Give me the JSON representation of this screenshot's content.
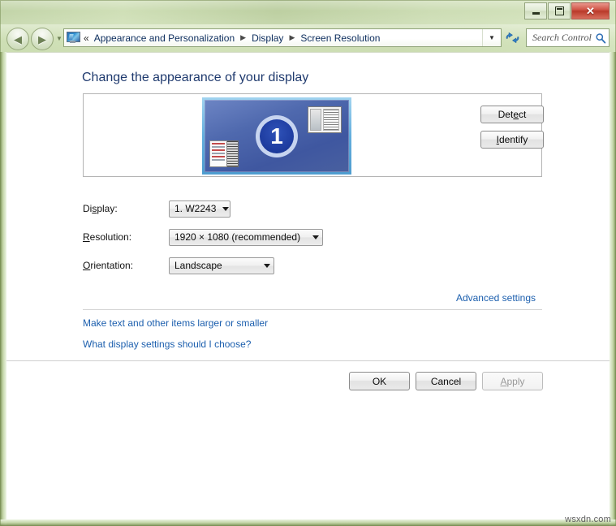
{
  "window": {
    "controls": {
      "minimize_label": "Minimize",
      "maximize_label": "Maximize",
      "close_label": "✕"
    }
  },
  "navigation": {
    "back_label": "◀",
    "forward_label": "▶",
    "history_dropdown_label": "▼",
    "address_icon": "display-monitor-icon",
    "overflow_label": "«",
    "breadcrumbs": [
      {
        "label": "Appearance and Personalization"
      },
      {
        "label": "Display"
      },
      {
        "label": "Screen Resolution"
      }
    ],
    "separator": "▶",
    "dropdown_label": "▼",
    "refresh_icon": "refresh-icon"
  },
  "search": {
    "placeholder": "Search Control ...",
    "value": "",
    "icon": "search-icon"
  },
  "page": {
    "title": "Change the appearance of your display"
  },
  "preview": {
    "monitor_number": "1",
    "window_thumbnail": "window-thumbnail-icon",
    "taskbar_thumbnail": "start-menu-thumbnail-icon"
  },
  "buttons": {
    "detect": {
      "prefix": "Det",
      "accel": "e",
      "suffix": "ct"
    },
    "identify": {
      "prefix": "",
      "accel": "I",
      "suffix": "dentify"
    },
    "ok": "OK",
    "cancel": "Cancel",
    "apply": {
      "prefix": "",
      "accel": "A",
      "suffix": "pply",
      "state": "disabled"
    }
  },
  "form": {
    "display": {
      "label_prefix": "Di",
      "label_accel": "s",
      "label_suffix": "play:",
      "value": "1. W2243"
    },
    "resolution": {
      "label_prefix": "",
      "label_accel": "R",
      "label_suffix": "esolution:",
      "value": "1920 × 1080 (recommended)"
    },
    "orientation": {
      "label_prefix": "",
      "label_accel": "O",
      "label_suffix": "rientation:",
      "value": "Landscape"
    }
  },
  "links": {
    "advanced_settings": "Advanced settings",
    "make_text_larger": "Make text and other items larger or smaller",
    "what_settings": "What display settings should I choose?"
  },
  "watermark": "wsxdn.com",
  "colors": {
    "frame_green": "#bcd1a0",
    "title_blue": "#1f3a6e",
    "link_blue": "#1c5fae",
    "monitor_blue": "#4f69ae",
    "close_red": "#b93a2a"
  }
}
